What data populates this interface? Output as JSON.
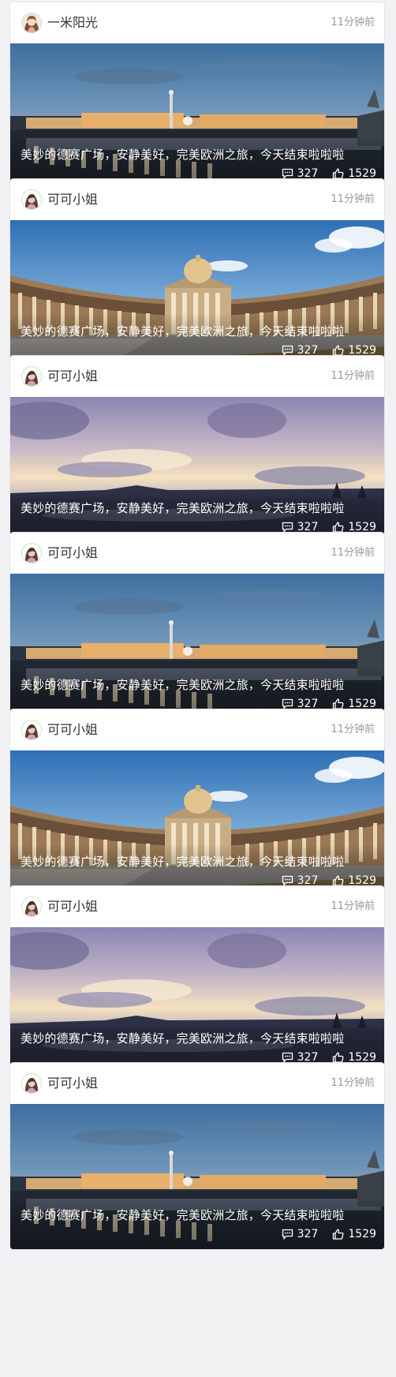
{
  "feed": {
    "posts": [
      {
        "username": "一米阳光",
        "time": "11分钟前",
        "caption": "美妙的德赛广场，安静美好，完美欧洲之旅，今天结束啦啦啦",
        "comments": "327",
        "likes": "1529",
        "scene": "night-square",
        "avatar_icon": "girl-avatar-icon"
      },
      {
        "username": "可可小姐",
        "time": "11分钟前",
        "caption": "美妙的德赛广场，安静美好，完美欧洲之旅，今天结束啦啦啦",
        "comments": "327",
        "likes": "1529",
        "scene": "colonnade",
        "avatar_icon": "woman-avatar-icon"
      },
      {
        "username": "可可小姐",
        "time": "11分钟前",
        "caption": "美妙的德赛广场，安静美好，完美欧洲之旅，今天结束啦啦啦",
        "comments": "327",
        "likes": "1529",
        "scene": "lake-sunset",
        "avatar_icon": "woman-avatar-icon"
      },
      {
        "username": "可可小姐",
        "time": "11分钟前",
        "caption": "美妙的德赛广场，安静美好，完美欧洲之旅，今天结束啦啦啦",
        "comments": "327",
        "likes": "1529",
        "scene": "night-square",
        "avatar_icon": "woman-avatar-icon"
      },
      {
        "username": "可可小姐",
        "time": "11分钟前",
        "caption": "美妙的德赛广场，安静美好，完美欧洲之旅，今天结束啦啦啦",
        "comments": "327",
        "likes": "1529",
        "scene": "colonnade",
        "avatar_icon": "woman-avatar-icon"
      },
      {
        "username": "可可小姐",
        "time": "11分钟前",
        "caption": "美妙的德赛广场，安静美好，完美欧洲之旅，今天结束啦啦啦",
        "comments": "327",
        "likes": "1529",
        "scene": "lake-sunset",
        "avatar_icon": "woman-avatar-icon"
      },
      {
        "username": "可可小姐",
        "time": "11分钟前",
        "caption": "美妙的德赛广场，安静美好，完美欧洲之旅，今天结束啦啦啦",
        "comments": "327",
        "likes": "1529",
        "scene": "night-square",
        "avatar_icon": "woman-avatar-icon"
      }
    ]
  },
  "icons": {
    "comment": "comment-icon",
    "like": "thumbs-up-icon"
  },
  "colors": {
    "page_bg": "#f2f2f4",
    "card_bg": "#ffffff",
    "username": "#333333",
    "time": "#999999",
    "caption": "#ffffff"
  }
}
